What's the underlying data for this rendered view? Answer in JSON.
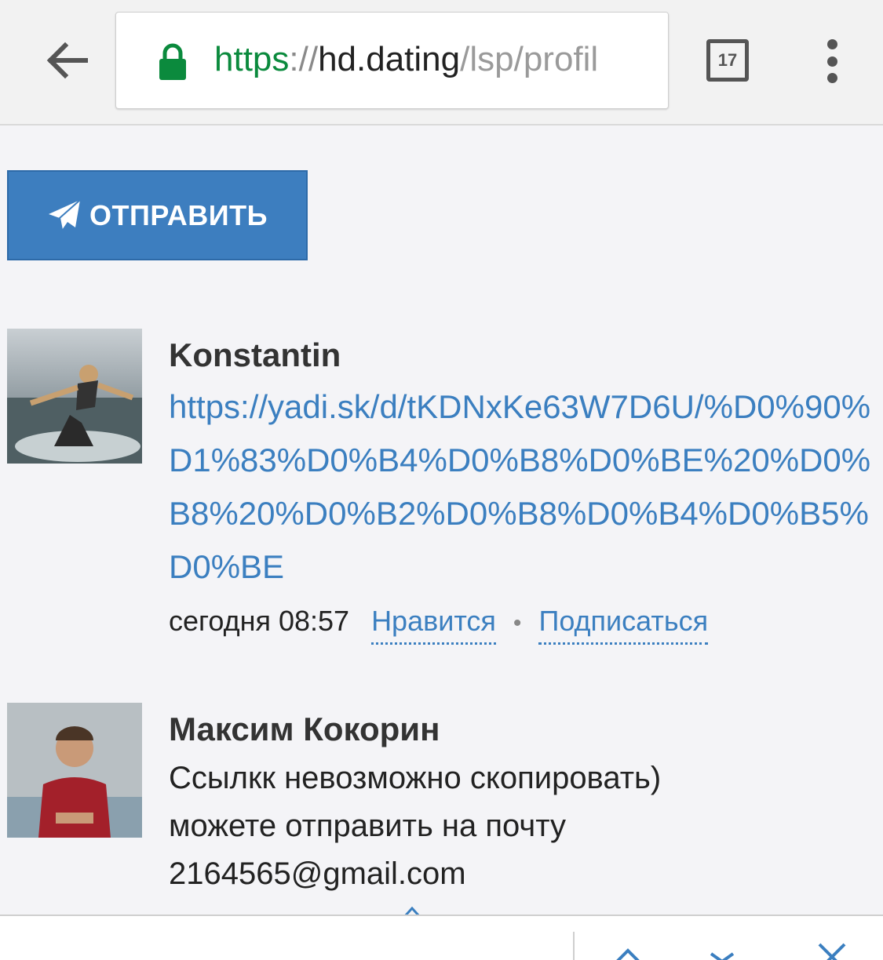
{
  "browser": {
    "url_scheme": "https",
    "url_sep": "://",
    "url_host": "hd.dating",
    "url_path": "/lsp/profil",
    "tab_count": "17",
    "icons": {
      "back": "arrow-left-icon",
      "lock": "lock-icon",
      "menu": "more-vert-icon"
    },
    "colors": {
      "secure": "#0b8a3d"
    }
  },
  "send_button": {
    "label": "ОТПРАВИТЬ",
    "icon": "paper-plane-icon",
    "color": "#3d7ebf"
  },
  "comments": [
    {
      "author": "Konstantin",
      "link": "https://yadi.sk/d/tKDNxKe63W7D6U/%D0%90%D1%83%D0%B4%D0%B8%D0%BE%20%D0%B8%20%D0%B2%D0%B8%D0%B4%D0%B5%D0%BE",
      "time": "сегодня 08:57",
      "like_label": "Нравится",
      "subscribe_label": "Подписаться",
      "separator": "•"
    },
    {
      "author": "Максим Кокорин",
      "text_lines": [
        "Ссылкк невозможно скопировать)",
        "можете отправить на почту",
        "2164565@gmail.com"
      ]
    }
  ],
  "find_bar": {
    "icons": [
      "chevron-up-icon",
      "chevron-down-icon",
      "close-icon"
    ]
  }
}
